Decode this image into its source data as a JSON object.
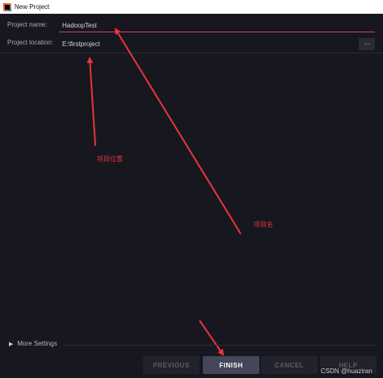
{
  "window": {
    "title": "New Project"
  },
  "form": {
    "name_label": "Project name:",
    "name_value": "HadoopTest",
    "location_label": "Project location:",
    "location_value": "E:\\firstproject",
    "browse_label": "..."
  },
  "annotations": {
    "location_note": "项目位置",
    "name_note": "项目名"
  },
  "more_settings": {
    "label": "More Settings"
  },
  "buttons": {
    "previous": "PREVIOUS",
    "finish": "FINISH",
    "cancel": "CANCEL",
    "help": "HELP"
  },
  "watermark": "CSDN @huaziran",
  "colors": {
    "background": "#17171f",
    "accent_underline": "#e8385d",
    "annotation": "#e8353e"
  }
}
